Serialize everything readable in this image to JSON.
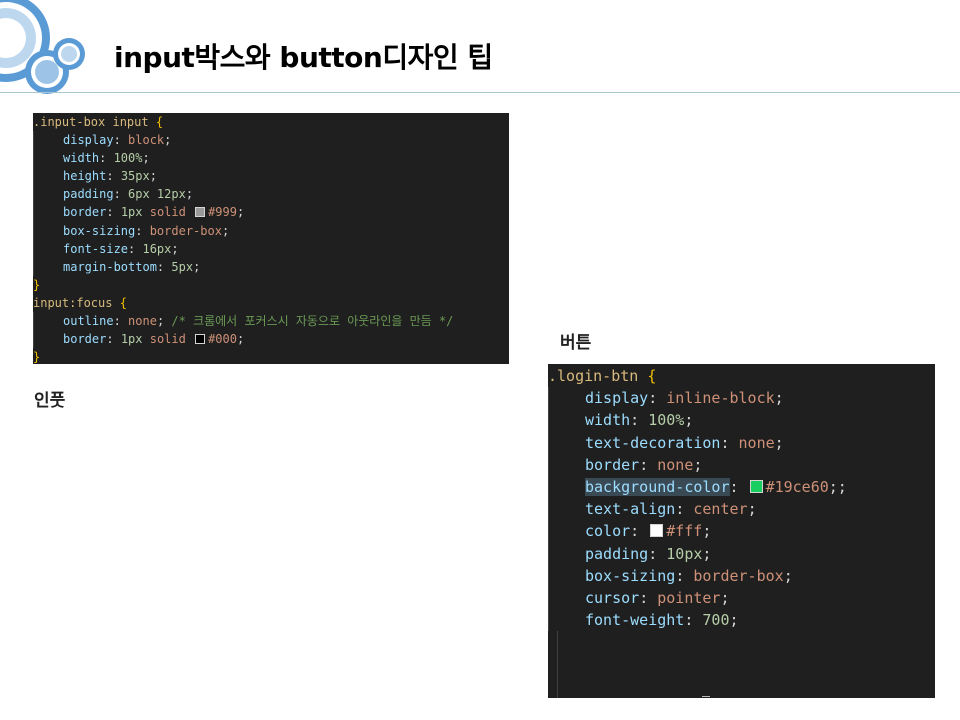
{
  "slide": {
    "title": "input박스와 button디자인 팁",
    "colors": {
      "accent": "#5b9bd5",
      "divider": "#a9c7d2",
      "editor_bg": "#1f1f1f"
    }
  },
  "labels": {
    "input": "인풋",
    "button": "버튼"
  },
  "code_input": {
    "lines": [
      {
        "indent": 0,
        "tokens": [
          {
            "t": ".input-box input ",
            "c": "sel"
          },
          {
            "t": "{",
            "c": "brace"
          }
        ]
      },
      {
        "indent": 1,
        "tokens": [
          {
            "t": "display",
            "c": "prop"
          },
          {
            "t": ": ",
            "c": "punc"
          },
          {
            "t": "block",
            "c": "val"
          },
          {
            "t": ";",
            "c": "punc"
          }
        ]
      },
      {
        "indent": 1,
        "tokens": [
          {
            "t": "width",
            "c": "prop"
          },
          {
            "t": ": ",
            "c": "punc"
          },
          {
            "t": "100%",
            "c": "num"
          },
          {
            "t": ";",
            "c": "punc"
          }
        ]
      },
      {
        "indent": 1,
        "tokens": [
          {
            "t": "height",
            "c": "prop"
          },
          {
            "t": ": ",
            "c": "punc"
          },
          {
            "t": "35px",
            "c": "num"
          },
          {
            "t": ";",
            "c": "punc"
          }
        ]
      },
      {
        "indent": 1,
        "tokens": [
          {
            "t": "padding",
            "c": "prop"
          },
          {
            "t": ": ",
            "c": "punc"
          },
          {
            "t": "6px 12px",
            "c": "num"
          },
          {
            "t": ";",
            "c": "punc"
          }
        ]
      },
      {
        "indent": 1,
        "tokens": [
          {
            "t": "border",
            "c": "prop"
          },
          {
            "t": ": ",
            "c": "punc"
          },
          {
            "t": "1px",
            "c": "num"
          },
          {
            "t": " solid ",
            "c": "val"
          },
          {
            "sw": "#999999"
          },
          {
            "t": "#999",
            "c": "val"
          },
          {
            "t": ";",
            "c": "punc"
          }
        ]
      },
      {
        "indent": 1,
        "tokens": [
          {
            "t": "box-sizing",
            "c": "prop"
          },
          {
            "t": ": ",
            "c": "punc"
          },
          {
            "t": "border-box",
            "c": "val"
          },
          {
            "t": ";",
            "c": "punc"
          }
        ]
      },
      {
        "indent": 1,
        "tokens": [
          {
            "t": "font-size",
            "c": "prop"
          },
          {
            "t": ": ",
            "c": "punc"
          },
          {
            "t": "16px",
            "c": "num"
          },
          {
            "t": ";",
            "c": "punc"
          }
        ]
      },
      {
        "indent": 1,
        "tokens": [
          {
            "t": "margin-bottom",
            "c": "prop"
          },
          {
            "t": ": ",
            "c": "punc"
          },
          {
            "t": "5px",
            "c": "num"
          },
          {
            "t": ";",
            "c": "punc"
          }
        ]
      },
      {
        "indent": 0,
        "tokens": [
          {
            "t": "}",
            "c": "brace"
          }
        ]
      },
      {
        "indent": 0,
        "tokens": [
          {
            "t": "input:focus ",
            "c": "sel"
          },
          {
            "t": "{",
            "c": "brace"
          }
        ]
      },
      {
        "indent": 1,
        "tokens": [
          {
            "t": "outline",
            "c": "prop"
          },
          {
            "t": ": ",
            "c": "punc"
          },
          {
            "t": "none",
            "c": "val"
          },
          {
            "t": "; ",
            "c": "punc"
          },
          {
            "t": "/* 크롬에서 포커스시 자동으로 아웃라인을 만듬 */",
            "c": "comment"
          }
        ]
      },
      {
        "indent": 1,
        "tokens": [
          {
            "t": "border",
            "c": "prop"
          },
          {
            "t": ": ",
            "c": "punc"
          },
          {
            "t": "1px",
            "c": "num"
          },
          {
            "t": " solid ",
            "c": "val"
          },
          {
            "sw": "#000000"
          },
          {
            "t": "#000",
            "c": "val"
          },
          {
            "t": ";",
            "c": "punc"
          }
        ]
      },
      {
        "indent": 0,
        "tokens": [
          {
            "t": "}",
            "c": "brace"
          }
        ]
      }
    ]
  },
  "code_button": {
    "lines": [
      {
        "indent": 0,
        "tokens": [
          {
            "t": ".login-btn ",
            "c": "sel"
          },
          {
            "t": "{",
            "c": "brace"
          }
        ]
      },
      {
        "indent": 1,
        "tokens": [
          {
            "t": "display",
            "c": "prop"
          },
          {
            "t": ": ",
            "c": "punc"
          },
          {
            "t": "inline-block",
            "c": "val"
          },
          {
            "t": ";",
            "c": "punc"
          }
        ]
      },
      {
        "indent": 1,
        "tokens": [
          {
            "t": "width",
            "c": "prop"
          },
          {
            "t": ": ",
            "c": "punc"
          },
          {
            "t": "100%",
            "c": "num"
          },
          {
            "t": ";",
            "c": "punc"
          }
        ]
      },
      {
        "indent": 1,
        "tokens": [
          {
            "t": "text-decoration",
            "c": "prop"
          },
          {
            "t": ": ",
            "c": "punc"
          },
          {
            "t": "none",
            "c": "val"
          },
          {
            "t": ";",
            "c": "punc"
          }
        ]
      },
      {
        "indent": 1,
        "tokens": [
          {
            "t": "border",
            "c": "prop"
          },
          {
            "t": ": ",
            "c": "punc"
          },
          {
            "t": "none",
            "c": "val"
          },
          {
            "t": ";",
            "c": "punc"
          }
        ]
      },
      {
        "indent": 1,
        "tokens": [
          {
            "t": "background-color",
            "c": "prop",
            "hl": true
          },
          {
            "t": ": ",
            "c": "punc"
          },
          {
            "sw": "#19ce60"
          },
          {
            "t": "#19ce60",
            "c": "val"
          },
          {
            "t": ";;",
            "c": "punc"
          }
        ]
      },
      {
        "indent": 1,
        "tokens": [
          {
            "t": "text-align",
            "c": "prop"
          },
          {
            "t": ": ",
            "c": "punc"
          },
          {
            "t": "center",
            "c": "val"
          },
          {
            "t": ";",
            "c": "punc"
          }
        ]
      },
      {
        "indent": 1,
        "tokens": [
          {
            "t": "color",
            "c": "prop"
          },
          {
            "t": ": ",
            "c": "punc"
          },
          {
            "sw": "#ffffff"
          },
          {
            "t": "#fff",
            "c": "val"
          },
          {
            "t": ";",
            "c": "punc"
          }
        ]
      },
      {
        "indent": 1,
        "tokens": [
          {
            "t": "padding",
            "c": "prop"
          },
          {
            "t": ": ",
            "c": "punc"
          },
          {
            "t": "10px",
            "c": "num"
          },
          {
            "t": ";",
            "c": "punc"
          }
        ]
      },
      {
        "indent": 1,
        "tokens": [
          {
            "t": "box-sizing",
            "c": "prop"
          },
          {
            "t": ": ",
            "c": "punc"
          },
          {
            "t": "border-box",
            "c": "val"
          },
          {
            "t": ";",
            "c": "punc"
          }
        ]
      },
      {
        "indent": 1,
        "tokens": [
          {
            "t": "cursor",
            "c": "prop"
          },
          {
            "t": ": ",
            "c": "punc"
          },
          {
            "t": "pointer",
            "c": "val"
          },
          {
            "t": ";",
            "c": "punc"
          }
        ]
      },
      {
        "indent": 1,
        "tokens": [
          {
            "t": "font-weight",
            "c": "prop"
          },
          {
            "t": ": ",
            "c": "punc"
          },
          {
            "t": "700",
            "c": "num"
          },
          {
            "t": ";",
            "c": "punc"
          }
        ]
      },
      {
        "indent": 1,
        "tokens": []
      },
      {
        "indent": 1,
        "tokens": []
      },
      {
        "indent": 1,
        "tokens": []
      },
      {
        "indent": 0,
        "tokens": [
          {
            "t": "}",
            "c": "brace"
          }
        ]
      }
    ]
  }
}
